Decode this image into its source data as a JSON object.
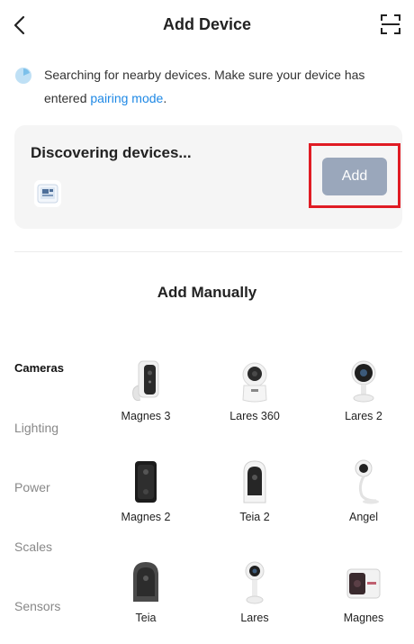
{
  "header": {
    "title": "Add Device",
    "back_icon": "chevron-left-icon",
    "scan_icon": "scan-icon"
  },
  "notice": {
    "text": "Searching for nearby devices. Make sure your device has entered",
    "link": "pairing mode",
    "tail": "."
  },
  "discover": {
    "title": "Discovering devices...",
    "add_label": "Add",
    "add_color": "#9aa7bb",
    "highlight_color": "#e01c24"
  },
  "manual": {
    "title": "Add Manually",
    "categories": [
      "Cameras",
      "Lighting",
      "Power",
      "Scales",
      "Sensors"
    ],
    "active_category": "Cameras",
    "products": [
      "Magnes 3",
      "Lares 360",
      "Lares 2",
      "Magnes 2",
      "Teia 2",
      "Angel",
      "Teia",
      "Lares",
      "Magnes"
    ]
  },
  "colors": {
    "link": "#1e88e5",
    "card_bg": "#f5f5f5"
  }
}
